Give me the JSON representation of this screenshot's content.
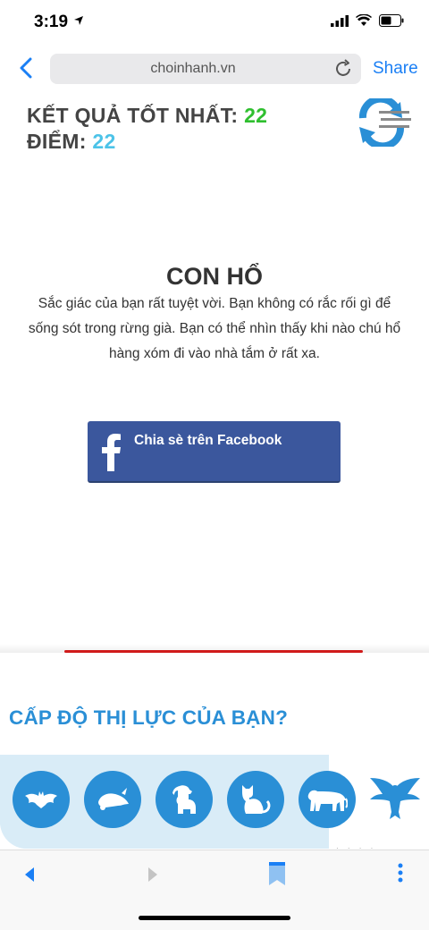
{
  "status_bar": {
    "time": "3:19"
  },
  "browser": {
    "url": "choinhanh.vn",
    "share_label": "Share"
  },
  "score": {
    "best_label": "KẾT QUẢ TỐT NHẤT:",
    "best_value": "22",
    "points_label": "ĐIỂM:",
    "points_value": "22"
  },
  "result": {
    "title": "CON HỔ",
    "description": "Sắc giác của bạn rất tuyệt vời. Bạn không có rắc rối gì để sống sót trong rừng già. Bạn có thể nhìn thấy khi nào chú hổ hàng xóm đi vào nhà tắm ở rất xa."
  },
  "share_button": {
    "label": "Chia sè trên Facebook"
  },
  "level": {
    "title": "CẤP ĐỘ THỊ LỰC CỦA BẠN?",
    "animals": [
      "bat-icon",
      "mole-icon",
      "dog-icon",
      "cat-icon",
      "tiger-icon",
      "eagle-icon"
    ]
  },
  "colors": {
    "accent": "#2a8fd6",
    "facebook": "#3b579d",
    "best_value": "#2fbf2f",
    "points_value": "#4cc3e8",
    "link": "#1a7ff5"
  }
}
